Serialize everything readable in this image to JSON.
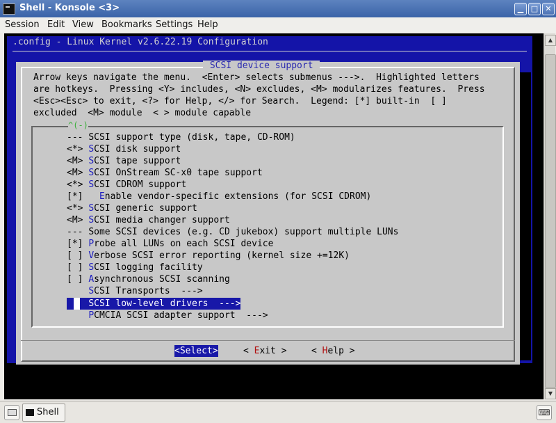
{
  "window": {
    "title": "Shell - Konsole <3>",
    "min_glyph": "▁",
    "max_glyph": "□",
    "close_glyph": "✕"
  },
  "menubar": [
    "Session",
    "Edit",
    "View",
    "Bookmarks",
    "Settings",
    "Help"
  ],
  "terminal": {
    "config_title": ".config - Linux Kernel v2.6.22.19 Configuration",
    "dialog_title": " SCSI device support ",
    "help_lines": [
      "Arrow keys navigate the menu.  <Enter> selects submenus --->.  Highlighted letters",
      "are hotkeys.  Pressing <Y> includes, <N> excludes, <M> modularizes features.  Press",
      "<Esc><Esc> to exit, <?> for Help, </> for Search.  Legend: [*] built-in  [ ]",
      "excluded  <M> module  < > module capable"
    ],
    "scroll_indicator": "^(-)",
    "items": [
      {
        "pre": "--- ",
        "hk": "",
        "rest": "SCSI support type (disk, tape, CD-ROM)"
      },
      {
        "pre": "<*> ",
        "hk": "S",
        "rest": "CSI disk support"
      },
      {
        "pre": "<M> ",
        "hk": "S",
        "rest": "CSI tape support"
      },
      {
        "pre": "<M> ",
        "hk": "S",
        "rest": "CSI OnStream SC-x0 tape support"
      },
      {
        "pre": "<*> ",
        "hk": "S",
        "rest": "CSI CDROM support"
      },
      {
        "pre": "[*]   ",
        "hk": "E",
        "rest": "nable vendor-specific extensions (for SCSI CDROM)"
      },
      {
        "pre": "<*> ",
        "hk": "S",
        "rest": "CSI generic support"
      },
      {
        "pre": "<M> ",
        "hk": "S",
        "rest": "CSI media changer support"
      },
      {
        "pre": "--- ",
        "hk": "",
        "rest": "Some SCSI devices (e.g. CD jukebox) support multiple LUNs"
      },
      {
        "pre": "[*] ",
        "hk": "P",
        "rest": "robe all LUNs on each SCSI device"
      },
      {
        "pre": "[ ] ",
        "hk": "V",
        "rest": "erbose SCSI error reporting (kernel size +=12K)"
      },
      {
        "pre": "[ ] ",
        "hk": "S",
        "rest": "CSI logging facility"
      },
      {
        "pre": "[ ] ",
        "hk": "A",
        "rest": "synchronous SCSI scanning"
      },
      {
        "pre": "    ",
        "hk": "S",
        "rest": "CSI Transports  --->"
      },
      {
        "pre": "    ",
        "hk": "S",
        "rest": "CSI low-level drivers  --->"
      },
      {
        "pre": "    ",
        "hk": "P",
        "rest": "CMCIA SCSI adapter support  --->"
      }
    ],
    "buttons": {
      "select": "<Select>",
      "exit_pre": "< ",
      "exit_hk": "E",
      "exit_rest": "xit >",
      "help_pre": "< ",
      "help_hk": "H",
      "help_rest": "elp >"
    }
  },
  "taskbar": {
    "task_label": "Shell"
  },
  "colors": {
    "terminal_blue": "#1414a8",
    "dialog_gray": "#c8c8c8",
    "selection": "#1818a8",
    "hotkey": "#1a1abf"
  }
}
